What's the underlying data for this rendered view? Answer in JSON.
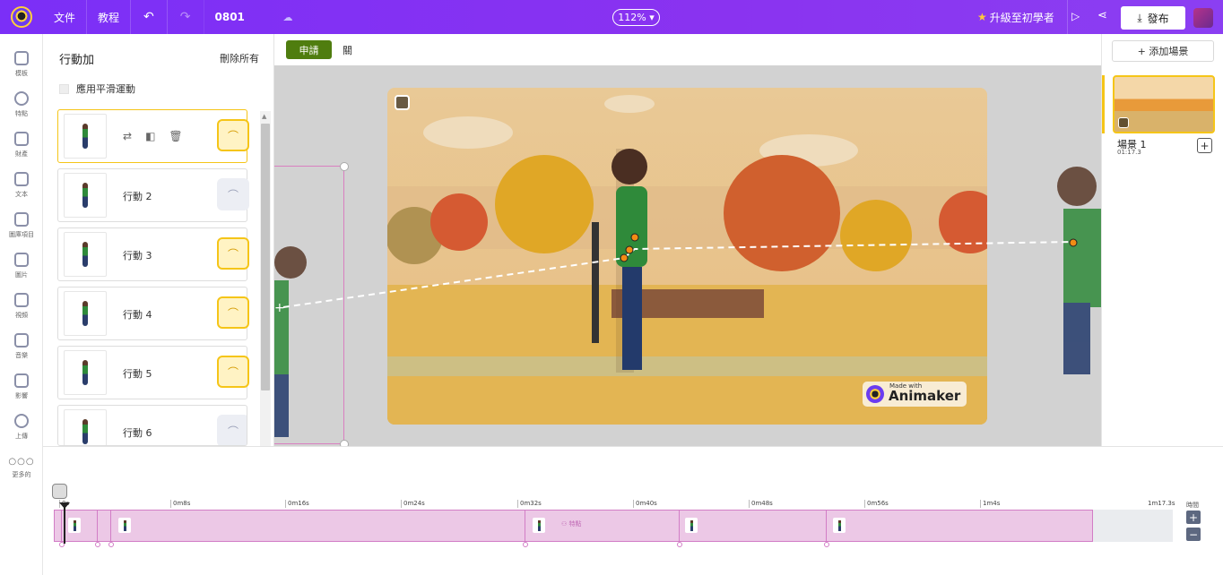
{
  "topbar": {
    "menu_file": "文件",
    "menu_tutorial": "教程",
    "undo_icon": "↶",
    "redo_icon": "↷",
    "project_name": "0801",
    "zoom": "112%",
    "upgrade_label": "升級至初學者",
    "publish_label": "發布"
  },
  "rail": {
    "items": [
      {
        "label": "模板",
        "icon": "template-icon"
      },
      {
        "label": "特點",
        "icon": "character-icon"
      },
      {
        "label": "財產",
        "icon": "props-icon"
      },
      {
        "label": "文本",
        "icon": "text-icon"
      },
      {
        "label": "圖庫項目",
        "icon": "library-icon"
      },
      {
        "label": "圖片",
        "icon": "image-icon"
      },
      {
        "label": "視頻",
        "icon": "video-icon"
      },
      {
        "label": "音樂",
        "icon": "music-icon"
      },
      {
        "label": "影響",
        "icon": "effects-icon"
      },
      {
        "label": "上傳",
        "icon": "upload-icon"
      },
      {
        "label": "更多的",
        "icon": "more-icon"
      }
    ]
  },
  "actions_panel": {
    "title": "行動加",
    "delete_all": "刪除所有",
    "smooth_motion": "應用平滑運動",
    "cards": [
      {
        "label": "",
        "motion_active": true,
        "selected": true
      },
      {
        "label": "行動 2",
        "motion_active": false,
        "selected": false
      },
      {
        "label": "行動 3",
        "motion_active": true,
        "selected": false
      },
      {
        "label": "行動 4",
        "motion_active": true,
        "selected": false
      },
      {
        "label": "行動 5",
        "motion_active": true,
        "selected": false
      },
      {
        "label": "行動 6",
        "motion_active": false,
        "selected": false
      }
    ]
  },
  "canvas": {
    "apply_label": "申請",
    "close_label": "關",
    "watermark_line1": "Made with",
    "watermark_line2": "Animaker"
  },
  "scenes": {
    "add_label": "+ 添加場景",
    "scene_name": "場景 1",
    "scene_duration": "01:17.3"
  },
  "timeline": {
    "ticks": [
      "0s",
      "0m8s",
      "0m16s",
      "0m24s",
      "0m32s",
      "0m40s",
      "0m48s",
      "0m56s",
      "1m4s",
      "1m17.3s"
    ],
    "track_label": "特點",
    "time_label": "時間"
  },
  "colors": {
    "accent": "#7b2ff7",
    "apply_green": "#4f7d0f",
    "highlight_yellow": "#f5c518",
    "track_pink": "#ecc8e6"
  }
}
